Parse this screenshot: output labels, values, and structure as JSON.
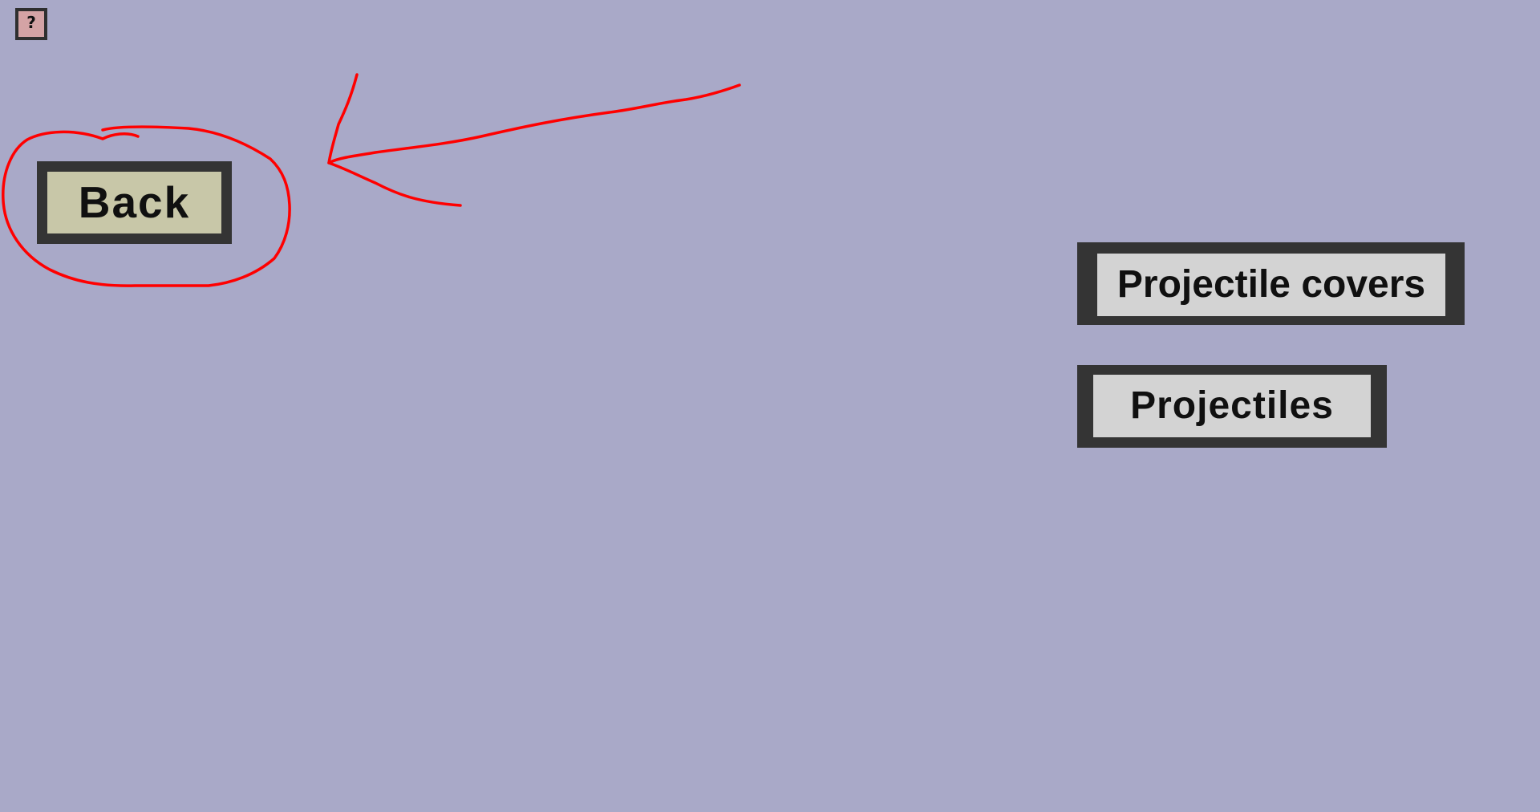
{
  "help_button": {
    "label": "?",
    "icon": "help-icon"
  },
  "buttons": {
    "back": "Back",
    "projectile_covers": "Projectile covers",
    "projectiles": "Projectiles"
  },
  "annotation": {
    "color": "#ff0000",
    "marks": [
      "circle-around-back-button",
      "arrow-pointing-to-back-button"
    ]
  },
  "colors": {
    "background": "#a9a9c8",
    "button_border": "#343434",
    "back_fill": "#c8c7a8",
    "menu_fill": "#d3d3d3",
    "help_fill": "#d4a3a5"
  }
}
